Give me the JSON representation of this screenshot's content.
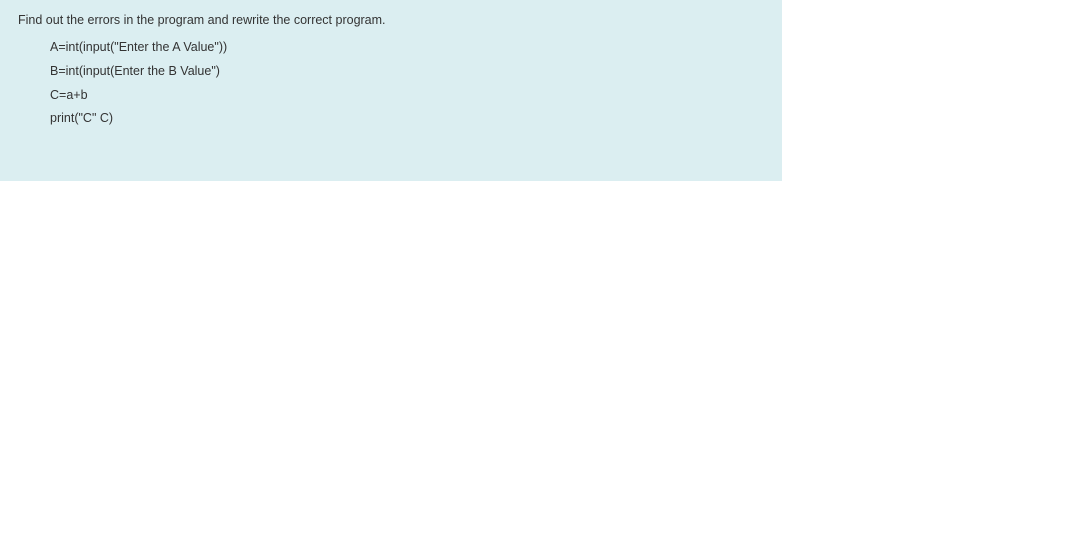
{
  "question": {
    "prompt": "Find out the errors in the program and rewrite the correct program.",
    "code_lines": [
      "A=int(input(\"Enter the A Value\"))",
      "B=int(input(Enter the B Value\")",
      "C=a+b",
      "print(\"C\" C)"
    ]
  }
}
